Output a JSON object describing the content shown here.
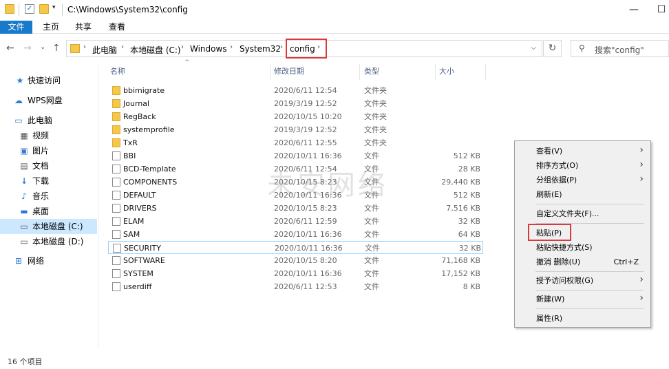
{
  "window": {
    "title_path": "C:\\Windows\\System32\\config",
    "minimize": "—",
    "maximize": "☐"
  },
  "ribbon": {
    "tabs": [
      "文件",
      "主页",
      "共享",
      "查看"
    ]
  },
  "address": {
    "breadcrumbs": [
      "此电脑",
      "本地磁盘 (C:)",
      "Windows",
      "System32",
      "config"
    ],
    "search_placeholder": "搜索\"config\""
  },
  "sidebar": {
    "items": [
      {
        "label": "快速访问",
        "icon": "star-icon"
      },
      {
        "label": "WPS网盘",
        "icon": "cloud-icon"
      },
      {
        "label": "此电脑",
        "icon": "computer-icon"
      },
      {
        "label": "视频",
        "icon": "video-icon"
      },
      {
        "label": "图片",
        "icon": "picture-icon"
      },
      {
        "label": "文档",
        "icon": "document-icon"
      },
      {
        "label": "下载",
        "icon": "download-icon"
      },
      {
        "label": "音乐",
        "icon": "music-icon"
      },
      {
        "label": "桌面",
        "icon": "desktop-icon"
      },
      {
        "label": "本地磁盘 (C:)",
        "icon": "drive-icon"
      },
      {
        "label": "本地磁盘 (D:)",
        "icon": "drive-icon"
      },
      {
        "label": "网络",
        "icon": "network-icon"
      }
    ]
  },
  "columns": {
    "name": "名称",
    "date": "修改日期",
    "type": "类型",
    "size": "大小"
  },
  "files": [
    {
      "name": "bbimigrate",
      "date": "2020/6/11 12:54",
      "type": "文件夹",
      "size": "",
      "kind": "folder"
    },
    {
      "name": "Journal",
      "date": "2019/3/19 12:52",
      "type": "文件夹",
      "size": "",
      "kind": "folder"
    },
    {
      "name": "RegBack",
      "date": "2020/10/15 10:20",
      "type": "文件夹",
      "size": "",
      "kind": "folder"
    },
    {
      "name": "systemprofile",
      "date": "2019/3/19 12:52",
      "type": "文件夹",
      "size": "",
      "kind": "folder"
    },
    {
      "name": "TxR",
      "date": "2020/6/11 12:55",
      "type": "文件夹",
      "size": "",
      "kind": "folder"
    },
    {
      "name": "BBI",
      "date": "2020/10/11 16:36",
      "type": "文件",
      "size": "512 KB",
      "kind": "file"
    },
    {
      "name": "BCD-Template",
      "date": "2020/6/11 12:54",
      "type": "文件",
      "size": "28 KB",
      "kind": "file"
    },
    {
      "name": "COMPONENTS",
      "date": "2020/10/15 8:23",
      "type": "文件",
      "size": "29,440 KB",
      "kind": "file"
    },
    {
      "name": "DEFAULT",
      "date": "2020/10/11 16:36",
      "type": "文件",
      "size": "512 KB",
      "kind": "file"
    },
    {
      "name": "DRIVERS",
      "date": "2020/10/15 8:23",
      "type": "文件",
      "size": "7,516 KB",
      "kind": "file"
    },
    {
      "name": "ELAM",
      "date": "2020/6/11 12:59",
      "type": "文件",
      "size": "32 KB",
      "kind": "file"
    },
    {
      "name": "SAM",
      "date": "2020/10/11 16:36",
      "type": "文件",
      "size": "64 KB",
      "kind": "file"
    },
    {
      "name": "SECURITY",
      "date": "2020/10/11 16:36",
      "type": "文件",
      "size": "32 KB",
      "kind": "file"
    },
    {
      "name": "SOFTWARE",
      "date": "2020/10/15 8:20",
      "type": "文件",
      "size": "71,168 KB",
      "kind": "file"
    },
    {
      "name": "SYSTEM",
      "date": "2020/10/11 16:36",
      "type": "文件",
      "size": "17,152 KB",
      "kind": "file"
    },
    {
      "name": "userdiff",
      "date": "2020/6/11 12:53",
      "type": "文件",
      "size": "8 KB",
      "kind": "file"
    }
  ],
  "watermark": "未安网络",
  "status": "16 个项目",
  "context_menu": {
    "items": [
      {
        "label": "查看(V)",
        "submenu": true
      },
      {
        "label": "排序方式(O)",
        "submenu": true
      },
      {
        "label": "分组依据(P)",
        "submenu": true
      },
      {
        "label": "刷新(E)"
      },
      {
        "label": "自定义文件夹(F)..."
      },
      {
        "label": "粘贴(P)"
      },
      {
        "label": "粘贴快捷方式(S)"
      },
      {
        "label": "撤消 删除(U)",
        "accel": "Ctrl+Z"
      },
      {
        "label": "授予访问权限(G)",
        "submenu": true
      },
      {
        "label": "新建(W)",
        "submenu": true
      },
      {
        "label": "属性(R)"
      }
    ]
  },
  "colors": {
    "accent": "#1979ca",
    "highlight": "#d93a3a",
    "selection": "#cce8ff"
  }
}
